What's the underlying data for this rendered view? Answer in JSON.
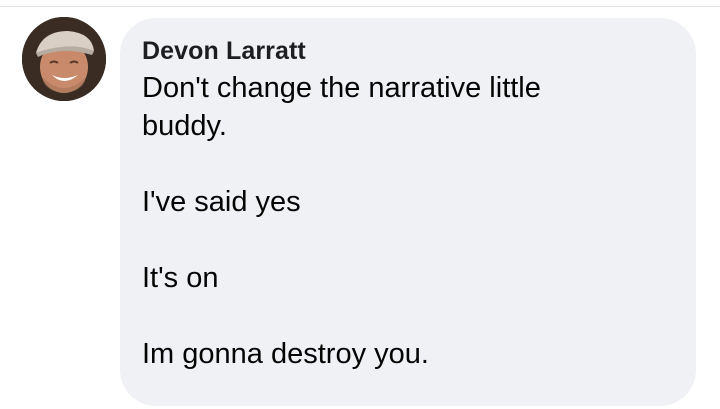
{
  "comment": {
    "author": "Devon Larratt",
    "avatar_icon": "profile-photo-avatar",
    "lines": [
      "Don't change the narrative little buddy.",
      "I've said yes",
      "It's on",
      "Im gonna destroy you."
    ]
  },
  "colors": {
    "bubble_background": "#eff1f4",
    "author_text": "#1c1e21",
    "body_text": "#050505"
  }
}
